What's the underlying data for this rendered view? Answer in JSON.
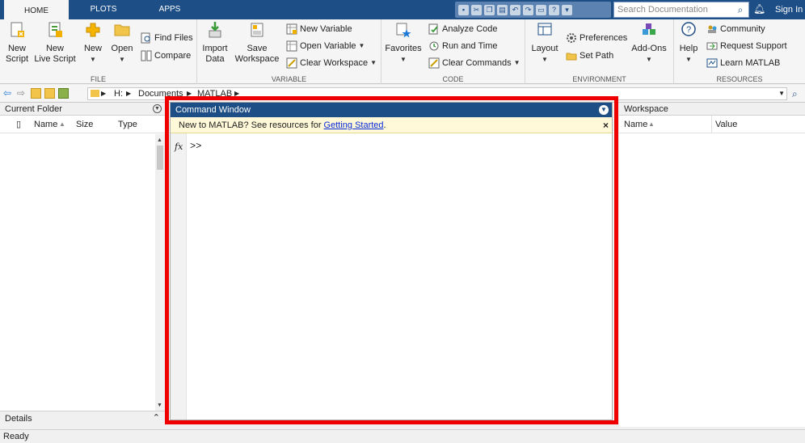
{
  "tabs": [
    "HOME",
    "PLOTS",
    "APPS"
  ],
  "search": {
    "placeholder": "Search Documentation"
  },
  "signin": "Sign In",
  "ribbon": {
    "file": {
      "label": "FILE",
      "new_script": "New\nScript",
      "new_live_script": "New\nLive Script",
      "new": "New",
      "open": "Open",
      "find_files": "Find Files",
      "compare": "Compare"
    },
    "variable": {
      "label": "VARIABLE",
      "import_data": "Import\nData",
      "save_workspace": "Save\nWorkspace",
      "new_variable": "New Variable",
      "open_variable": "Open Variable",
      "clear_workspace": "Clear Workspace"
    },
    "code": {
      "label": "CODE",
      "favorites": "Favorites",
      "analyze_code": "Analyze Code",
      "run_and_time": "Run and Time",
      "clear_commands": "Clear Commands"
    },
    "environment": {
      "label": "ENVIRONMENT",
      "layout": "Layout",
      "preferences": "Preferences",
      "set_path": "Set Path",
      "addons": "Add-Ons"
    },
    "resources": {
      "label": "RESOURCES",
      "help": "Help",
      "community": "Community",
      "request_support": "Request Support",
      "learn_matlab": "Learn MATLAB"
    }
  },
  "address": {
    "path": [
      "H:",
      "Documents",
      "MATLAB"
    ]
  },
  "current_folder": {
    "title": "Current Folder",
    "columns": [
      "Name",
      "Size",
      "Type"
    ]
  },
  "details": {
    "title": "Details"
  },
  "command_window": {
    "title": "Command Window",
    "banner_text": "New to MATLAB? See resources for ",
    "banner_link": "Getting Started",
    "banner_end": ".",
    "close": "×",
    "fx": "fx",
    "prompt": ">>"
  },
  "workspace": {
    "title": "Workspace",
    "columns": [
      "Name",
      "Value"
    ]
  },
  "status": "Ready",
  "colors": {
    "accent": "#1d4e86",
    "highlight": "#ee0000"
  }
}
